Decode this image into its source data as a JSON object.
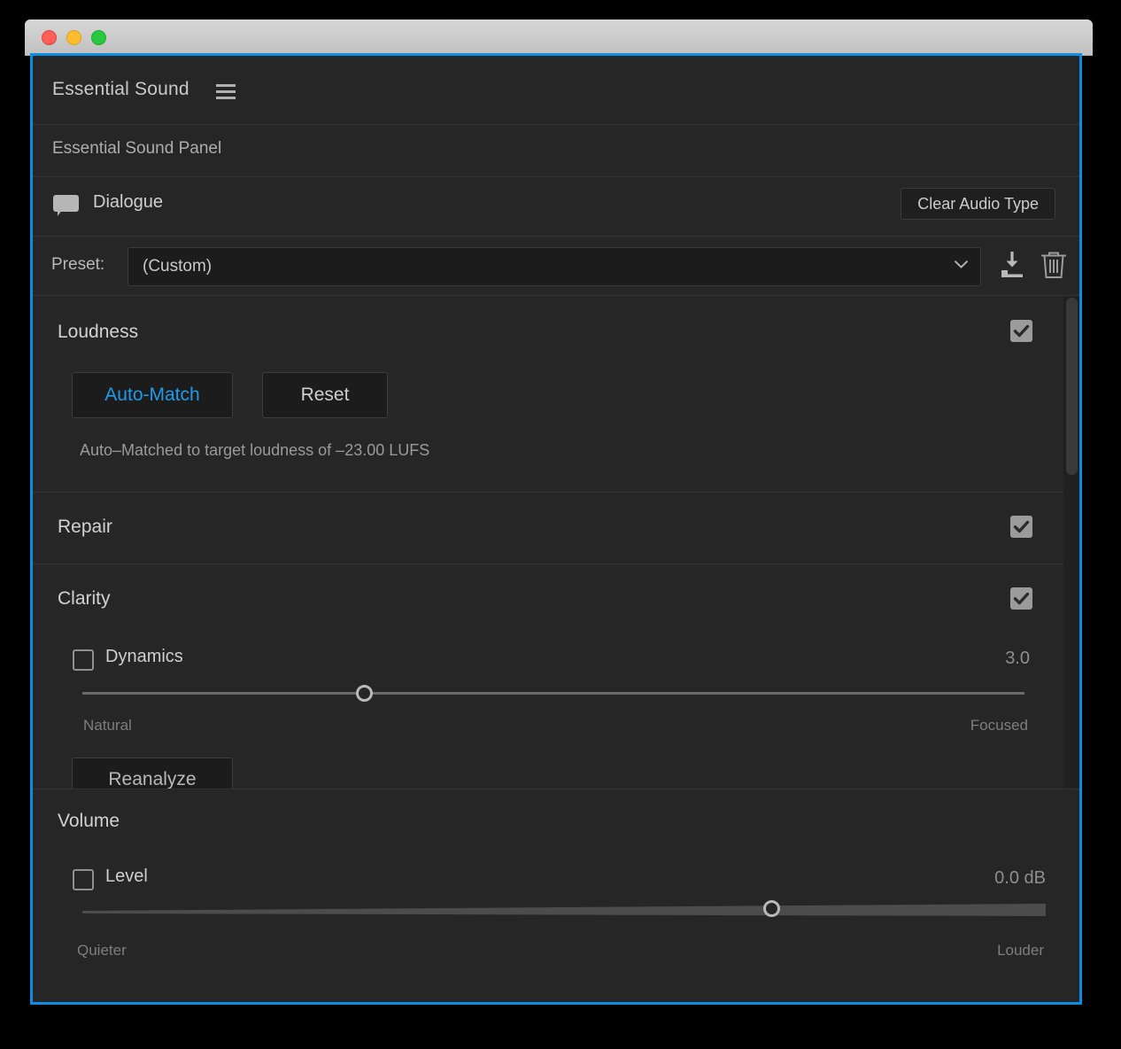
{
  "window": {
    "traffic_lights": [
      "close",
      "minimize",
      "maximize"
    ],
    "colors": {
      "close": "#ff5f57",
      "minimize": "#febc2e",
      "maximize": "#28c840",
      "accent": "#0e8ce0",
      "link": "#1e9bea",
      "panel_bg": "#262626"
    }
  },
  "panel": {
    "title": "Essential Sound",
    "menu_icon": "hamburger-menu-icon",
    "subtitle": "Essential Sound Panel"
  },
  "audio_type": {
    "icon": "speech-bubble-icon",
    "label": "Dialogue",
    "clear_button": "Clear Audio Type"
  },
  "preset": {
    "label": "Preset:",
    "value": "(Custom)",
    "placeholder": "(Custom)",
    "chevron_icon": "chevron-down-icon",
    "save_icon": "save-preset-icon",
    "delete_icon": "trash-icon"
  },
  "sections": {
    "loudness": {
      "title": "Loudness",
      "enabled": true,
      "auto_match_button": "Auto-Match",
      "reset_button": "Reset",
      "status": "Auto–Matched to target loudness of –23.00 LUFS"
    },
    "repair": {
      "title": "Repair",
      "enabled": true
    },
    "clarity": {
      "title": "Clarity",
      "enabled": true,
      "dynamics": {
        "label": "Dynamics",
        "checked": false,
        "value": "3.0",
        "min_label": "Natural",
        "max_label": "Focused",
        "position_pct": 30
      },
      "reanalyze_button": "Reanalyze"
    },
    "volume": {
      "title": "Volume",
      "level": {
        "label": "Level",
        "checked": false,
        "value": "0.0 dB",
        "min_label": "Quieter",
        "max_label": "Louder",
        "position_pct": 71
      }
    }
  }
}
